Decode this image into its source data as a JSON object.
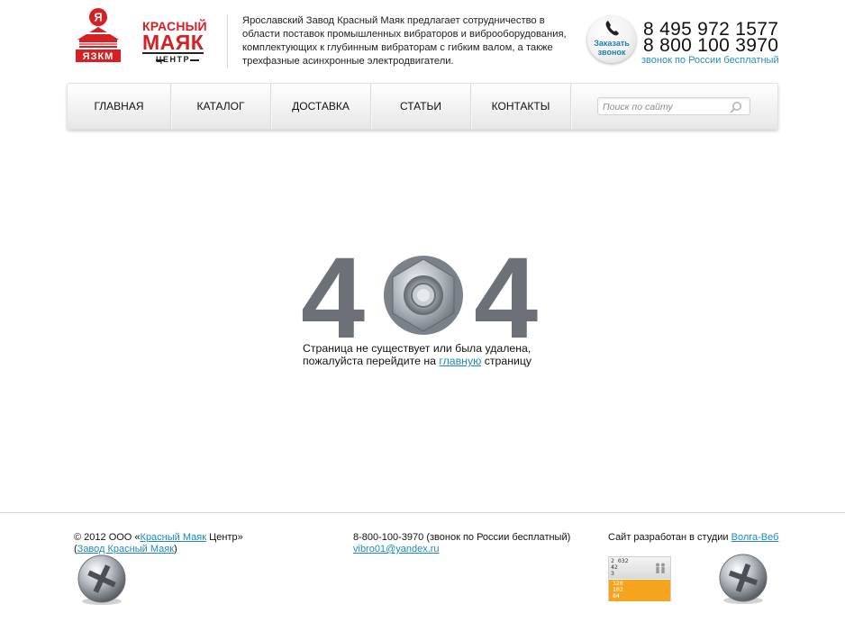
{
  "header": {
    "logo": {
      "emblem_letter": "Я",
      "emblem_banner": "ЯЗКМ",
      "brand_line1": "КРАСНЫЙ",
      "brand_line2": "МАЯК",
      "brand_line3": "ЦЕНТР"
    },
    "description": "Ярославский Завод Красный Маяк предлагает сотрудничество в области поставок промышленных вибраторов и виброоборудования, комплектующих к глубинным вибраторам с гибким валом, а также трехфазные асинхронные электродвигатели.",
    "callback_button": {
      "line1": "Заказать",
      "line2": "звонок"
    },
    "phone1": "8 495 972 1577",
    "phone2": "8 800 100 3970",
    "phone_note": "звонок по России бесплатный"
  },
  "nav": {
    "items": [
      {
        "label": "ГЛАВНАЯ"
      },
      {
        "label": "КАТАЛОГ"
      },
      {
        "label": "ДОСТАВКА"
      },
      {
        "label": "СТАТЬИ"
      },
      {
        "label": "КОНТАКТЫ"
      }
    ],
    "search_placeholder": "Поиск по сайту"
  },
  "error": {
    "digit_left": "4",
    "digit_right": "4",
    "line1": "Страница не существует или была удалена,",
    "line2_prefix": "пожалуйста перейдите на ",
    "line2_link": "главную",
    "line2_suffix": " страницу"
  },
  "footer": {
    "col1": {
      "prefix": "© 2012 ООО «",
      "link1": "Красный Маяк",
      "middle": " Центр»",
      "open_paren": "(",
      "link2": "Завод Красный Маяк",
      "close_paren": ")"
    },
    "col2": {
      "phone": "8-800-100-3970 (звонок по России бесплатный)",
      "email": "vibro01@yandex.ru"
    },
    "col3": {
      "prefix": "Сайт разработан в студии ",
      "studio_link": "Волга-Веб"
    },
    "counter": {
      "top_values": [
        "2 032",
        "42",
        "3"
      ],
      "bottom_values": [
        "320",
        "102",
        "84"
      ]
    }
  },
  "colors": {
    "brand_red": "#d62024",
    "link_blue": "#1e88c0",
    "digit_gray": "#6c7178",
    "counter_orange": "#f6a31e"
  }
}
